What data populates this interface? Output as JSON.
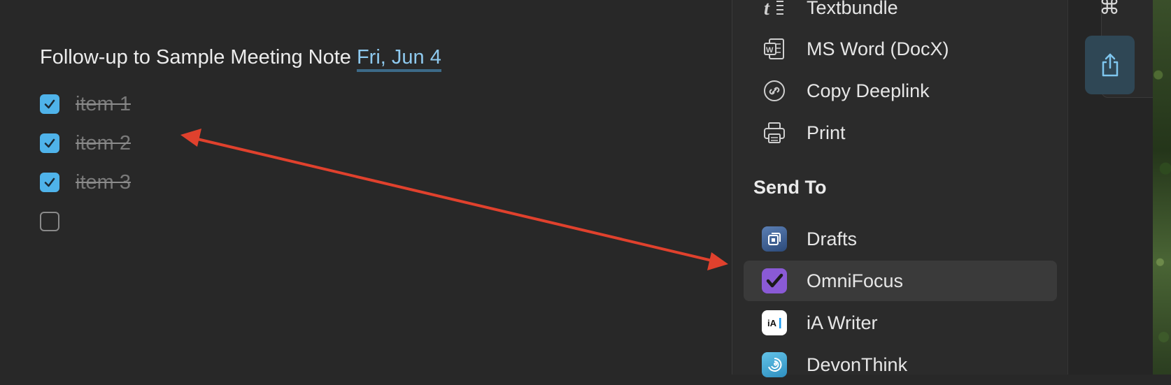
{
  "note": {
    "title_text": "Follow-up to Sample Meeting Note",
    "date_text": "Fri, Jun 4",
    "tasks": [
      {
        "label": "item 1",
        "checked": true
      },
      {
        "label": "item 2",
        "checked": true
      },
      {
        "label": "item 3",
        "checked": true
      },
      {
        "label": "",
        "checked": false
      }
    ]
  },
  "share_menu": {
    "export_items": [
      {
        "label": "Textbundle",
        "icon": "textbundle-icon"
      },
      {
        "label": "MS Word (DocX)",
        "icon": "ms-word-icon"
      },
      {
        "label": "Copy Deeplink",
        "icon": "link-icon"
      },
      {
        "label": "Print",
        "icon": "printer-icon"
      }
    ],
    "send_to_heading": "Send To",
    "send_to_items": [
      {
        "label": "Drafts",
        "icon": "drafts-app-icon"
      },
      {
        "label": "OmniFocus",
        "icon": "omnifocus-app-icon",
        "highlighted": true
      },
      {
        "label": "iA Writer",
        "icon": "ia-writer-app-icon"
      },
      {
        "label": "DevonThink",
        "icon": "devonthink-app-icon"
      }
    ]
  },
  "toolbar": {
    "command_glyph": "⌘",
    "share_icon": "share-icon"
  },
  "annotation": {
    "type": "double-headed-arrow",
    "color": "#e0412d"
  },
  "colors": {
    "accent": "#4fb3ea",
    "date_link": "#8ec9ee",
    "omnifocus": "#8a5ad6"
  }
}
